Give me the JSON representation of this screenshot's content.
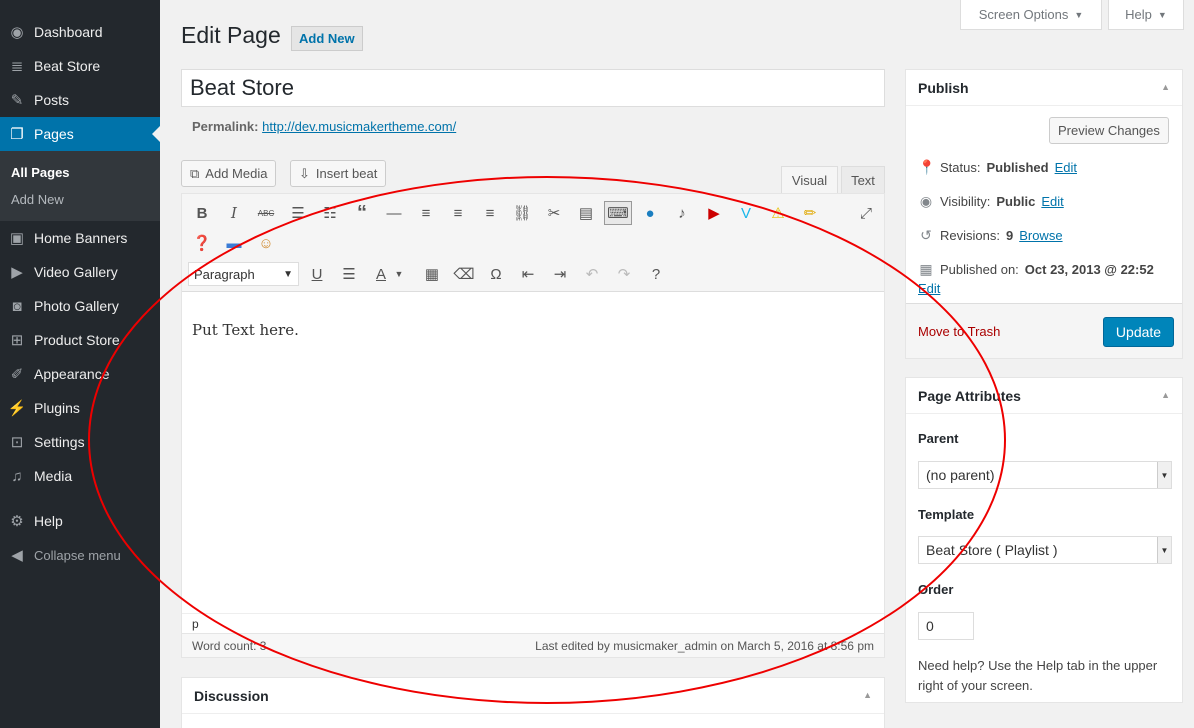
{
  "sidebar": {
    "items": [
      {
        "label": "Dashboard",
        "icon": "dashboard-icon"
      },
      {
        "label": "Beat Store",
        "icon": "playlist-icon"
      },
      {
        "label": "Posts",
        "icon": "pin-icon"
      },
      {
        "label": "Pages",
        "icon": "pages-icon"
      },
      {
        "label": "Home Banners",
        "icon": "banner-icon"
      },
      {
        "label": "Video Gallery",
        "icon": "video-icon"
      },
      {
        "label": "Photo Gallery",
        "icon": "camera-icon"
      },
      {
        "label": "Product Store",
        "icon": "cart-icon"
      },
      {
        "label": "Appearance",
        "icon": "brush-icon"
      },
      {
        "label": "Plugins",
        "icon": "plugin-icon"
      },
      {
        "label": "Settings",
        "icon": "settings-icon"
      },
      {
        "label": "Media",
        "icon": "media-icon"
      },
      {
        "label": "Help",
        "icon": "gear-icon"
      }
    ],
    "submenu": [
      "All Pages",
      "Add New"
    ],
    "collapse_label": "Collapse menu"
  },
  "top": {
    "screen_options": "Screen Options",
    "help": "Help"
  },
  "header": {
    "title": "Edit Page",
    "add_new": "Add New"
  },
  "post": {
    "title": "Beat Store",
    "permalink_label": "Permalink:",
    "permalink_url": "http://dev.musicmakertheme.com/"
  },
  "media": {
    "add_media": "Add Media",
    "insert_beat": "Insert beat"
  },
  "editor": {
    "tab_visual": "Visual",
    "tab_text": "Text",
    "format_value": "Paragraph",
    "content": "Put Text here.",
    "path": "p",
    "word_count": "Word count: 3",
    "last_edited": "Last edited by musicmaker_admin on March 5, 2016 at 8:56 pm"
  },
  "publish": {
    "title": "Publish",
    "preview": "Preview Changes",
    "status_label": "Status:",
    "status_value": "Published",
    "visibility_label": "Visibility:",
    "visibility_value": "Public",
    "revisions_label": "Revisions:",
    "revisions_value": "9",
    "browse": "Browse",
    "published_label": "Published on:",
    "published_value": "Oct 23, 2013 @ 22:52",
    "edit": "Edit",
    "trash": "Move to Trash",
    "update": "Update"
  },
  "attributes": {
    "title": "Page Attributes",
    "parent_label": "Parent",
    "parent_value": "(no parent)",
    "template_label": "Template",
    "template_value": "Beat Store ( Playlist )",
    "order_label": "Order",
    "order_value": "0",
    "help_text": "Need help? Use the Help tab in the upper right of your screen."
  },
  "discussion": {
    "title": "Discussion"
  },
  "colors": {
    "accent": "#0073aa",
    "sidebar": "#23282d",
    "annotation": "#e00000"
  }
}
